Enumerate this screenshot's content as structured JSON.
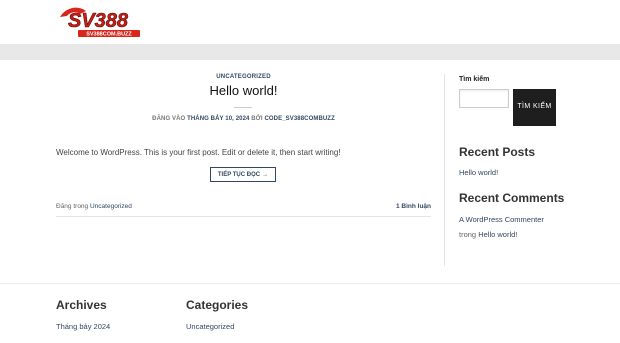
{
  "header": {
    "logo_text": "SV388",
    "logo_subtext": "SV388COM.BUZZ"
  },
  "post": {
    "category": "UNCATEGORIZED",
    "title": "Hello world!",
    "meta_prefix": "ĐĂNG VÀO",
    "date": "THÁNG BẢY 10, 2024",
    "meta_by": "BỞI",
    "author": "CODE_SV388COMBUZZ",
    "excerpt": "Welcome to WordPress. This is your first post. Edit or delete it, then start writing!",
    "read_more": "TIẾP TỤC ĐỌC",
    "read_more_arrow": "→",
    "posted_in": "Đăng trong",
    "posted_category": "Uncategorized",
    "comment_count": "1",
    "comment_label": "Bình luận"
  },
  "sidebar": {
    "search_label": "Tìm kiếm",
    "search_value": "",
    "search_button": "TÌM KIẾM",
    "recent_posts_title": "Recent Posts",
    "recent_posts": [
      "Hello world!"
    ],
    "recent_comments_title": "Recent Comments",
    "comment_author": "A WordPress Commenter",
    "comment_on": "trong",
    "comment_post": "Hello world!"
  },
  "footer": {
    "archives_title": "Archives",
    "archives": [
      "Tháng bảy 2024"
    ],
    "categories_title": "Categories",
    "categories": [
      "Uncategorized"
    ]
  }
}
